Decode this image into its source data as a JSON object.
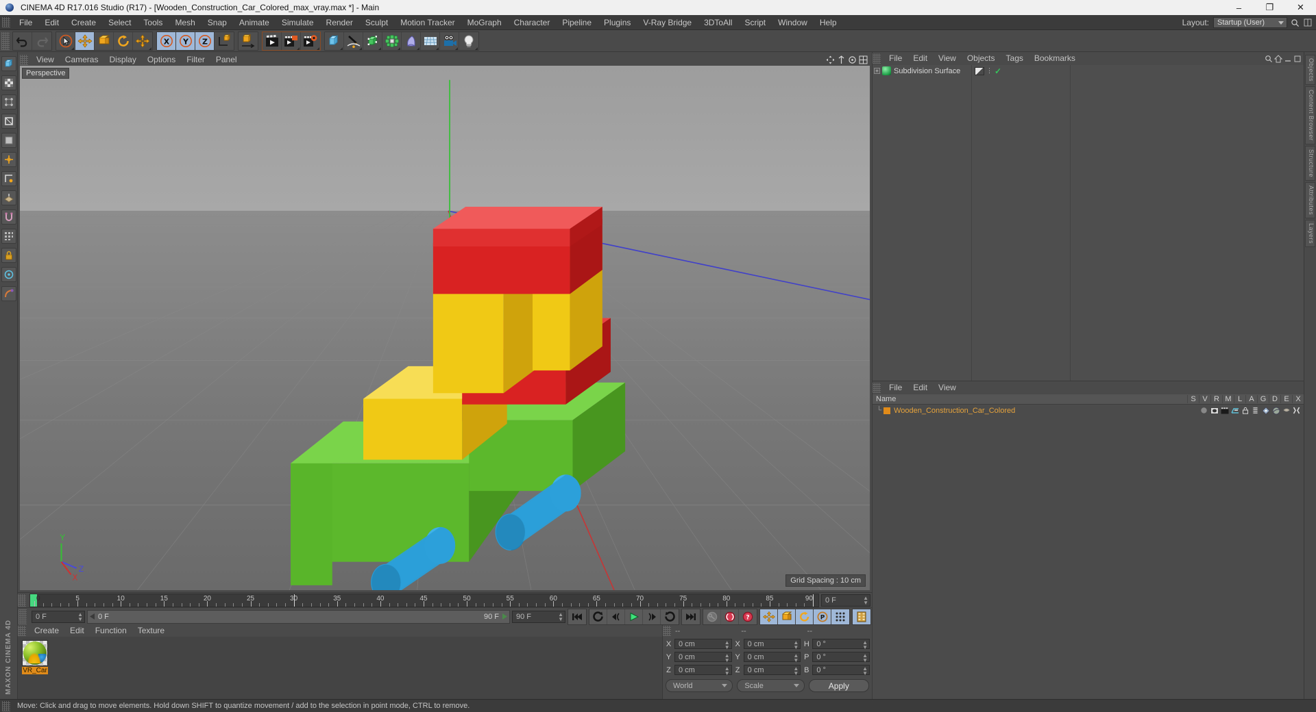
{
  "window": {
    "title": "CINEMA 4D R17.016 Studio (R17) - [Wooden_Construction_Car_Colored_max_vray.max *] - Main",
    "minimize": "–",
    "maximize": "❐",
    "close": "✕"
  },
  "menubar": {
    "items": [
      "File",
      "Edit",
      "Create",
      "Select",
      "Tools",
      "Mesh",
      "Snap",
      "Animate",
      "Simulate",
      "Render",
      "Sculpt",
      "Motion Tracker",
      "MoGraph",
      "Character",
      "Pipeline",
      "Plugins",
      "V-Ray Bridge",
      "3DToAll",
      "Script",
      "Window",
      "Help"
    ],
    "layout_label": "Layout:",
    "layout_value": "Startup (User)",
    "search_icon": "search-icon"
  },
  "toolbar": {
    "groups": [
      {
        "name": "history",
        "buttons": [
          {
            "name": "undo-button",
            "icon": "undo-arrow",
            "state": "normal"
          },
          {
            "name": "redo-button",
            "icon": "redo-arrow",
            "state": "disabled"
          }
        ]
      },
      {
        "name": "transform-tools",
        "buttons": [
          {
            "name": "live-selection-tool",
            "icon": "cursor-circle",
            "state": "normal"
          },
          {
            "name": "move-tool",
            "icon": "four-arrows",
            "state": "active"
          },
          {
            "name": "scale-tool",
            "icon": "scale-box",
            "state": "normal"
          },
          {
            "name": "rotate-tool",
            "icon": "rotate-circle",
            "state": "normal"
          },
          {
            "name": "move-duplicate-tool",
            "icon": "four-arrows",
            "state": "normal"
          }
        ]
      },
      {
        "name": "axis-locks",
        "buttons": [
          {
            "name": "x-axis-lock",
            "icon": "letter-x",
            "state": "active"
          },
          {
            "name": "y-axis-lock",
            "icon": "letter-y",
            "state": "active"
          },
          {
            "name": "z-axis-lock",
            "icon": "letter-z",
            "state": "active"
          },
          {
            "name": "world-object-axis",
            "icon": "axis-cube",
            "state": "normal"
          }
        ]
      },
      {
        "name": "coordinate-system",
        "buttons": [
          {
            "name": "coordinate-system-toggle",
            "icon": "cube-arrow",
            "state": "normal"
          }
        ]
      },
      {
        "name": "render-tools",
        "buttons": [
          {
            "name": "render-view-button",
            "icon": "clapper",
            "state": "normal"
          },
          {
            "name": "render-to-picture-viewer-button",
            "icon": "clapper-picture",
            "state": "normal"
          },
          {
            "name": "render-settings-button",
            "icon": "clapper-gear",
            "state": "normal"
          }
        ]
      },
      {
        "name": "create-objects",
        "buttons": [
          {
            "name": "add-cube-button",
            "icon": "blue-cube",
            "state": "normal"
          },
          {
            "name": "add-spline-button",
            "icon": "pen-spline",
            "state": "normal"
          },
          {
            "name": "add-generator-button",
            "icon": "green-cube",
            "state": "normal"
          },
          {
            "name": "add-mograph-button",
            "icon": "green-cloner",
            "state": "normal"
          },
          {
            "name": "add-deformer-button",
            "icon": "bend-deformer",
            "state": "normal"
          },
          {
            "name": "add-environment-button",
            "icon": "floor-grid",
            "state": "normal"
          },
          {
            "name": "add-camera-button",
            "icon": "camera",
            "state": "normal"
          },
          {
            "name": "add-light-button",
            "icon": "lightbulb",
            "state": "normal"
          }
        ]
      }
    ]
  },
  "left_rail": {
    "buttons": [
      "model-mode-icon",
      "texture-mode-icon",
      "points-mode-icon",
      "edges-mode-icon",
      "polygons-mode-icon",
      "object-axis-icon",
      "enable-axis-icon",
      "workplane-icon",
      "snap-icon",
      "quantize-icon",
      "lock-icon",
      "viewport-solo-icon",
      "deform-icon"
    ],
    "brand": "MAXON CINEMA 4D"
  },
  "viewport": {
    "menus": [
      "View",
      "Cameras",
      "Display",
      "Options",
      "Filter",
      "Panel"
    ],
    "label": "Perspective",
    "grid_spacing": "Grid Spacing : 10 cm",
    "axis_gizmo": {
      "x": "X",
      "y": "Y",
      "z": "Z"
    }
  },
  "timeline": {
    "tick_labels": [
      0,
      5,
      10,
      15,
      20,
      25,
      30,
      35,
      40,
      45,
      50,
      55,
      60,
      65,
      70,
      75,
      80,
      85,
      90
    ],
    "frame_min": 0,
    "frame_max": 90,
    "current_frame_field": "0 F",
    "start_field": "0 F",
    "range_start": "0 F",
    "range_end": "90 F",
    "end_field": "90 F"
  },
  "transport": {
    "buttons": [
      {
        "name": "go-to-start-button",
        "icon": "skip-back-icon"
      },
      {
        "name": "play-backwards-button",
        "icon": "rewind-icon"
      },
      {
        "name": "previous-frame-button",
        "icon": "step-back-icon"
      },
      {
        "name": "play-forwards-button",
        "icon": "play-icon"
      },
      {
        "name": "next-frame-button",
        "icon": "step-forward-icon"
      },
      {
        "name": "play-loop-button",
        "icon": "loop-icon"
      },
      {
        "name": "go-to-end-button",
        "icon": "skip-forward-icon"
      },
      {
        "name": "record-active-objects-button",
        "icon": "key-icon"
      },
      {
        "name": "autokeying-button",
        "icon": "autokey-icon"
      },
      {
        "name": "keyframe-selection-button",
        "icon": "question-key-icon"
      },
      {
        "name": "position-key-button",
        "icon": "move-key-icon"
      },
      {
        "name": "scale-key-button",
        "icon": "scale-key-icon"
      },
      {
        "name": "rotation-key-button",
        "icon": "rotate-key-icon"
      },
      {
        "name": "parameter-key-button",
        "icon": "param-key-icon"
      },
      {
        "name": "point-level-animation-button",
        "icon": "pla-icon"
      },
      {
        "name": "timeline-button",
        "icon": "film-icon"
      }
    ]
  },
  "material_manager": {
    "menus": [
      "Create",
      "Edit",
      "Function",
      "Texture"
    ],
    "materials": [
      {
        "name": "VR_Car",
        "preview": "multicolor-sphere"
      }
    ]
  },
  "coordinates": {
    "headers": [
      "--",
      "--",
      "--"
    ],
    "rows": [
      {
        "pos_axis": "X",
        "pos_value": "0 cm",
        "size_axis": "X",
        "size_value": "0 cm",
        "rot_axis": "H",
        "rot_value": "0 °"
      },
      {
        "pos_axis": "Y",
        "pos_value": "0 cm",
        "size_axis": "Y",
        "size_value": "0 cm",
        "rot_axis": "P",
        "rot_value": "0 °"
      },
      {
        "pos_axis": "Z",
        "pos_value": "0 cm",
        "size_axis": "Z",
        "size_value": "0 cm",
        "rot_axis": "B",
        "rot_value": "0 °"
      }
    ],
    "system_dropdown": "World",
    "mode_dropdown": "Scale",
    "apply_button": "Apply"
  },
  "object_manager": {
    "menus": [
      "File",
      "Edit",
      "View",
      "Objects",
      "Tags",
      "Bookmarks"
    ],
    "objects": [
      {
        "name": "Subdivision Surface",
        "icon": "subdivision-surface-icon",
        "expandable": true,
        "tags": [
          "subdivision-tag",
          "visibility-dots",
          "green-check"
        ]
      }
    ]
  },
  "structure_manager": {
    "menus": [
      "File",
      "Edit",
      "View"
    ],
    "name_column": "Name",
    "columns": [
      "S",
      "V",
      "R",
      "M",
      "L",
      "A",
      "G",
      "D",
      "E",
      "X"
    ],
    "rows": [
      {
        "name": "Wooden_Construction_Car_Colored",
        "icons": [
          "sphere-icon",
          "display-icon",
          "render-icon",
          "material-icon",
          "lock-icon",
          "layer-icon",
          "generator-icon",
          "deformer-icon",
          "environment-icon",
          "xpresso-icon"
        ]
      }
    ]
  },
  "right_rail": {
    "tabs": [
      "Objects",
      "Content Browser",
      "Structure",
      "Attributes",
      "Layers"
    ]
  },
  "statusbar": {
    "message": "Move: Click and drag to move elements. Hold down SHIFT to quantize movement / add to the selection in point mode, CTRL to remove."
  },
  "scene": {
    "model_name": "Wooden Construction Car Colored",
    "colors": {
      "red": "#d92222",
      "red_dark": "#a81414",
      "red_light": "#e84040",
      "yellow": "#f5cf1a",
      "yellow_dark": "#d6a210",
      "yellow_light": "#ffe34a",
      "green": "#52b82a",
      "green_dark": "#3d8c1e",
      "green_light": "#78d648",
      "blue": "#2b9fd9",
      "blue_dark": "#1e7fb4",
      "blue_light": "#52bce8"
    },
    "axes": {
      "x_color": "#d03030",
      "y_color": "#3ec03e",
      "z_color": "#4040d0"
    }
  }
}
